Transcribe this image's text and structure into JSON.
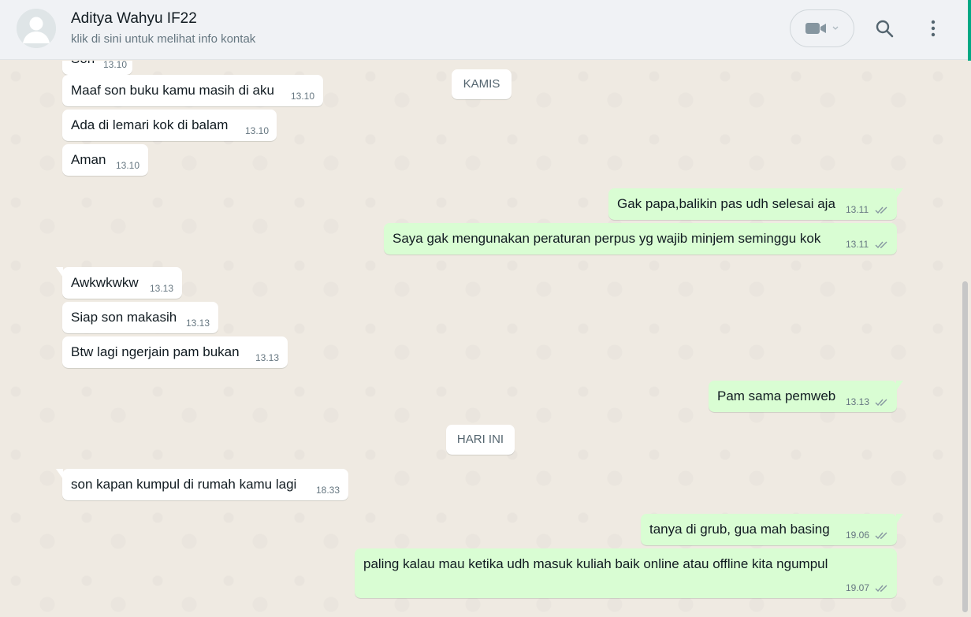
{
  "header": {
    "contact_name": "Aditya Wahyu IF22",
    "contact_subtitle": "klik di sini untuk melihat info kontak"
  },
  "icons": {
    "avatar": "avatar-placeholder-icon",
    "video": "video-camera-icon",
    "dropdown": "chevron-down-icon",
    "search": "search-icon",
    "menu": "vertical-dots-icon",
    "read": "double-check-icon"
  },
  "colors": {
    "incoming_bubble": "#ffffff",
    "outgoing_bubble": "#d9fdd3",
    "background": "#efeae2",
    "read_ticks": "#8696a0"
  },
  "day_separators": {
    "kamis": "KAMIS",
    "hari_ini": "HARI INI"
  },
  "messages": {
    "m0": {
      "text": "Son",
      "time": "13.10"
    },
    "m1": {
      "text": "Maaf son buku kamu masih di aku",
      "time": "13.10"
    },
    "m2": {
      "text": "Ada di lemari kok di balam",
      "time": "13.10"
    },
    "m3": {
      "text": "Aman",
      "time": "13.10"
    },
    "m4": {
      "text": "Gak papa,balikin pas udh selesai aja",
      "time": "13.11"
    },
    "m5": {
      "text": "Saya gak mengunakan peraturan perpus yg wajib minjem seminggu kok",
      "time": "13.11"
    },
    "m6": {
      "text": "Awkwkwkw",
      "time": "13.13"
    },
    "m7": {
      "text": "Siap son makasih",
      "time": "13.13"
    },
    "m8": {
      "text": "Btw lagi ngerjain pam bukan",
      "time": "13.13"
    },
    "m9": {
      "text": "Pam sama pemweb",
      "time": "13.13"
    },
    "m10": {
      "text": "son kapan kumpul di rumah kamu lagi",
      "time": "18.33"
    },
    "m11": {
      "text": "tanya di grub, gua mah basing",
      "time": "19.06"
    },
    "m12": {
      "text": "paling kalau mau ketika udh masuk kuliah baik online atau offline kita ngumpul",
      "time": "19.07"
    }
  }
}
